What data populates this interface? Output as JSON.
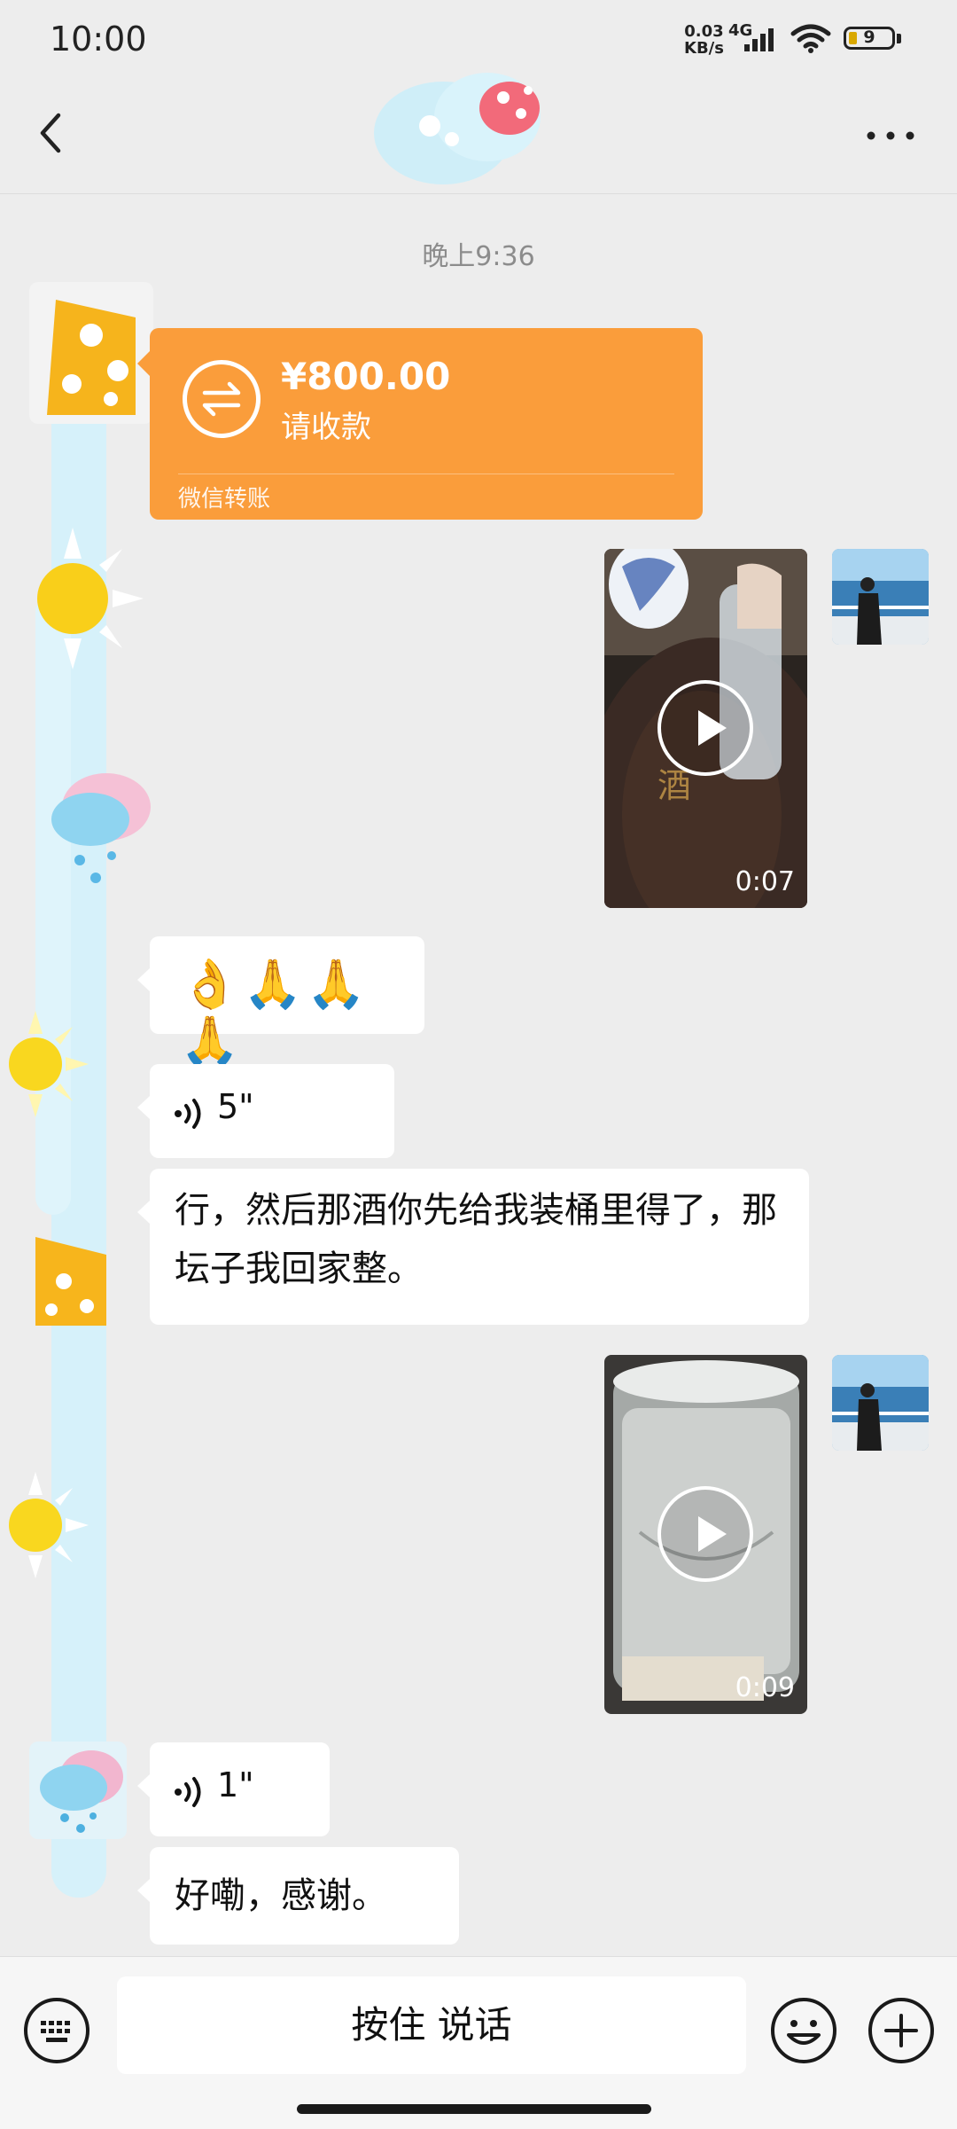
{
  "status_bar": {
    "time": "10:00",
    "net_speed_value": "0.03",
    "net_speed_unit": "KB/s",
    "network_type": "4G",
    "battery": "9"
  },
  "chat": {
    "timestamp": "晚上9:36",
    "transfer": {
      "amount": "¥800.00",
      "status": "请收款",
      "label": "微信转账"
    },
    "video1": {
      "duration": "0:07"
    },
    "emoji_message": "👌🙏🙏🙏",
    "voice1": {
      "duration": "5\""
    },
    "text1": "行，然后那酒你先给我装桶里得了，那坛子我回家整。",
    "video2": {
      "duration": "0:09"
    },
    "voice2": {
      "duration": "1\""
    },
    "text2": "好嘞，感谢。"
  },
  "input_bar": {
    "hold_to_talk": "按住 说话"
  }
}
